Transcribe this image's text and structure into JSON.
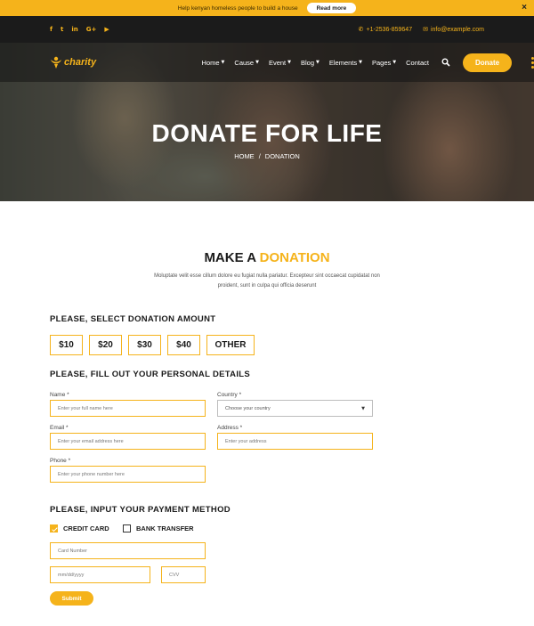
{
  "notice": {
    "text": "Help kenyan homeless people to build a house",
    "button": "Read more",
    "close": "×"
  },
  "topbar": {
    "socials": [
      "f",
      "t",
      "in",
      "G+",
      "▶"
    ],
    "phone": "+1-2536-859647",
    "email": "info@example.com"
  },
  "nav": {
    "logo_text": "charity",
    "items": [
      {
        "label": "Home",
        "has_dropdown": true
      },
      {
        "label": "Cause",
        "has_dropdown": true
      },
      {
        "label": "Event",
        "has_dropdown": true
      },
      {
        "label": "Blog",
        "has_dropdown": true
      },
      {
        "label": "Elements",
        "has_dropdown": true
      },
      {
        "label": "Pages",
        "has_dropdown": true
      },
      {
        "label": "Contact",
        "has_dropdown": false
      }
    ],
    "donate_label": "Donate"
  },
  "hero": {
    "title": "DONATE FOR LIFE",
    "breadcrumb_home": "HOME",
    "breadcrumb_sep": "/",
    "breadcrumb_current": "DONATION"
  },
  "section": {
    "title_main": "MAKE A",
    "title_accent": "DONATION",
    "description": "Moluptate velit esse cillum dolore eu fugiat nulla pariatur. Excepteur sint occaecat cupidatat non proident, sunt in culpa qui officia deserunt"
  },
  "amount": {
    "heading": "PLEASE, SELECT DONATION AMOUNT",
    "options": [
      "$10",
      "$20",
      "$30",
      "$40",
      "OTHER"
    ]
  },
  "personal": {
    "heading": "PLEASE, FILL OUT YOUR PERSONAL DETAILS",
    "name_label": "Name *",
    "name_placeholder": "Enter your full name here",
    "country_label": "Country *",
    "country_value": "Choose your country",
    "email_label": "Email *",
    "email_placeholder": "Enter your email address here",
    "address_label": "Address *",
    "address_placeholder": "Enter your address",
    "phone_label": "Phone *",
    "phone_placeholder": "Enter your phone number here"
  },
  "payment": {
    "heading": "PLEASE, INPUT YOUR PAYMENT METHOD",
    "credit_card_label": "CREDIT CARD",
    "credit_card_checked": true,
    "bank_transfer_label": "BANK TRANSFER",
    "bank_transfer_checked": false,
    "card_number_placeholder": "Card Number",
    "date_placeholder": "mm/dd/yyyy",
    "cvv_placeholder": "CVV",
    "submit_label": "Submit"
  },
  "colors": {
    "accent": "#f5b31b",
    "dark": "#1b1b1b"
  }
}
